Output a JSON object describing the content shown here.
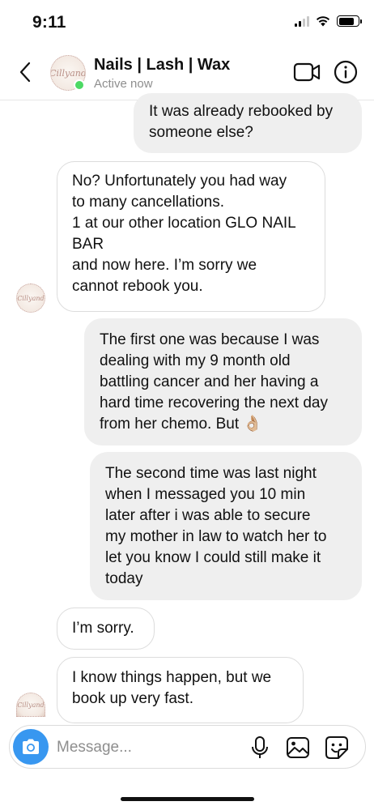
{
  "status_bar": {
    "time": "9:11",
    "signal_icon": "cellular-signal-icon",
    "wifi_icon": "wifi-icon",
    "battery_icon": "battery-icon"
  },
  "header": {
    "back_icon": "chevron-left-icon",
    "avatar_text": "Cillyand",
    "title": "Nails | Lash | Wax",
    "status": "Active now",
    "video_icon": "video-camera-icon",
    "info_icon": "info-icon",
    "active_color": "#4cd964"
  },
  "messages": [
    {
      "from": "me",
      "text": "It was already rebooked by\nsomeone else?"
    },
    {
      "from": "them",
      "text": "No? Unfortunately you had way\nto many cancellations.\n1 at our other location GLO NAIL\nBAR\nand now here. I’m sorry we\ncannot rebook you."
    },
    {
      "from": "me",
      "text": "The first one was because I was\ndealing with my 9 month old\nbattling cancer and her having a\nhard time recovering the next day\nfrom her chemo. But 👌🏼"
    },
    {
      "from": "me",
      "text": "The second time was last night\nwhen I messaged you 10 min\nlater after i was able to secure\nmy mother in law to watch her to\nlet you know I could still make it\ntoday"
    },
    {
      "from": "them",
      "text": "I’m sorry."
    },
    {
      "from": "them",
      "text": "I know things happen, but we\nbook up very fast."
    }
  ],
  "composer": {
    "placeholder": "Message...",
    "camera_icon": "camera-icon",
    "mic_icon": "microphone-icon",
    "gallery_icon": "image-gallery-icon",
    "sticker_icon": "sticker-icon",
    "accent": "#3897f0"
  }
}
